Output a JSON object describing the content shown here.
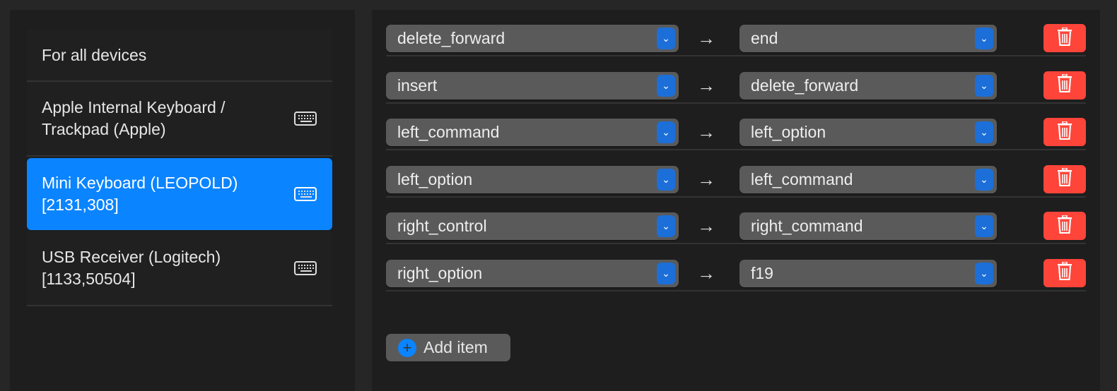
{
  "devices": [
    {
      "label": "For all devices",
      "icon": "none",
      "selected": false
    },
    {
      "label": "Apple Internal Keyboard / Trackpad (Apple)",
      "icon": "keyboard-icon",
      "selected": false
    },
    {
      "label": "Mini Keyboard (LEOPOLD) [2131,308]",
      "icon": "keyboard-icon",
      "selected": true
    },
    {
      "label": "USB Receiver (Logitech) [1133,50504]",
      "icon": "keyboard-icon",
      "selected": false
    }
  ],
  "mappings": [
    {
      "from": "delete_forward",
      "to": "end"
    },
    {
      "from": "insert",
      "to": "delete_forward"
    },
    {
      "from": "left_command",
      "to": "left_option"
    },
    {
      "from": "left_option",
      "to": "left_command"
    },
    {
      "from": "right_control",
      "to": "right_command"
    },
    {
      "from": "right_option",
      "to": "f19"
    }
  ],
  "arrow": "→",
  "chevron": "⌄",
  "add_item_label": "Add item",
  "colors": {
    "accent": "#0a84ff",
    "delete": "#ff453a",
    "popup": "#5a5a5a"
  }
}
